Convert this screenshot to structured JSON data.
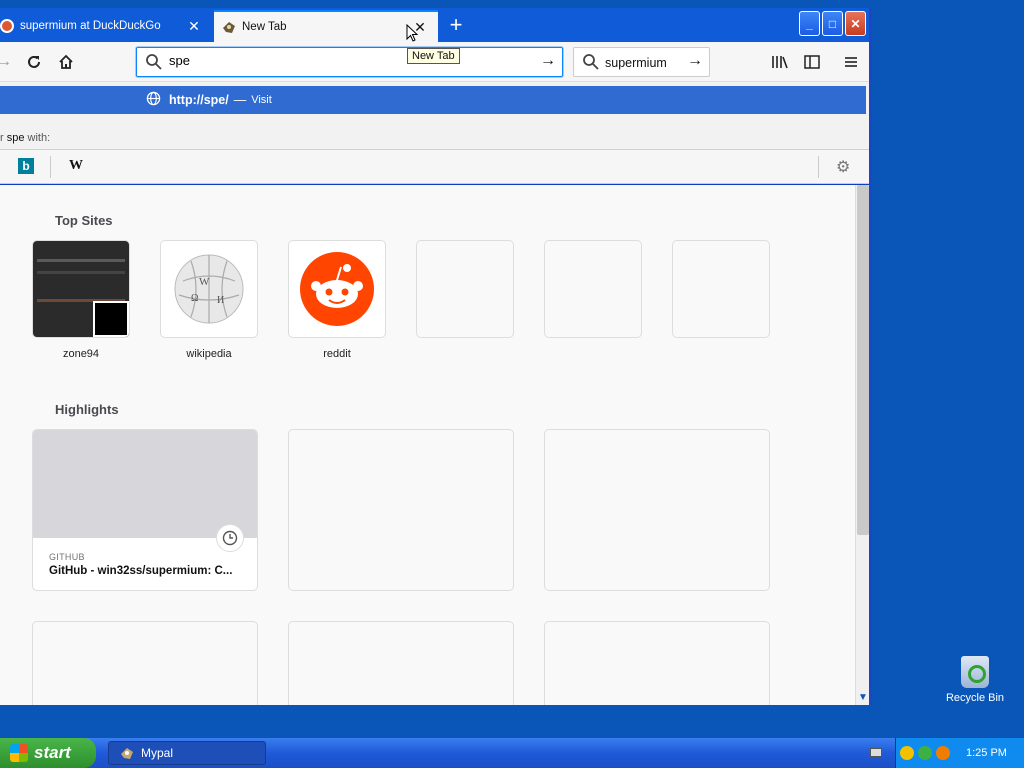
{
  "browser": {
    "tabs": [
      {
        "title": "supermium at DuckDuckGo",
        "active": false
      },
      {
        "title": "New Tab",
        "active": true
      }
    ],
    "tooltip": "New Tab",
    "url_value": "spe",
    "search_value": "supermium",
    "autocomplete": {
      "url": "http://spe/",
      "dash": "—",
      "action": "Visit"
    },
    "search_with": {
      "query": "spe",
      "suffix": "with:"
    }
  },
  "engines": [
    "bing",
    "wikipedia"
  ],
  "newtab": {
    "top_sites_title": "Top Sites",
    "top_sites": [
      {
        "name": "zone94"
      },
      {
        "name": "wikipedia"
      },
      {
        "name": "reddit"
      },
      {
        "name": ""
      },
      {
        "name": ""
      },
      {
        "name": ""
      }
    ],
    "highlights_title": "Highlights",
    "highlights": [
      {
        "source": "GITHUB",
        "title": "GitHub - win32ss/supermium: C..."
      }
    ]
  },
  "desktop": {
    "recycle_bin": "Recycle Bin"
  },
  "taskbar": {
    "start_label": "start",
    "task_label": "Mypal",
    "clock": "1:25 PM"
  },
  "colors": {
    "accent": "#0a84ff",
    "reddit": "#ff4500",
    "taskbar": "#1f5ad8"
  }
}
